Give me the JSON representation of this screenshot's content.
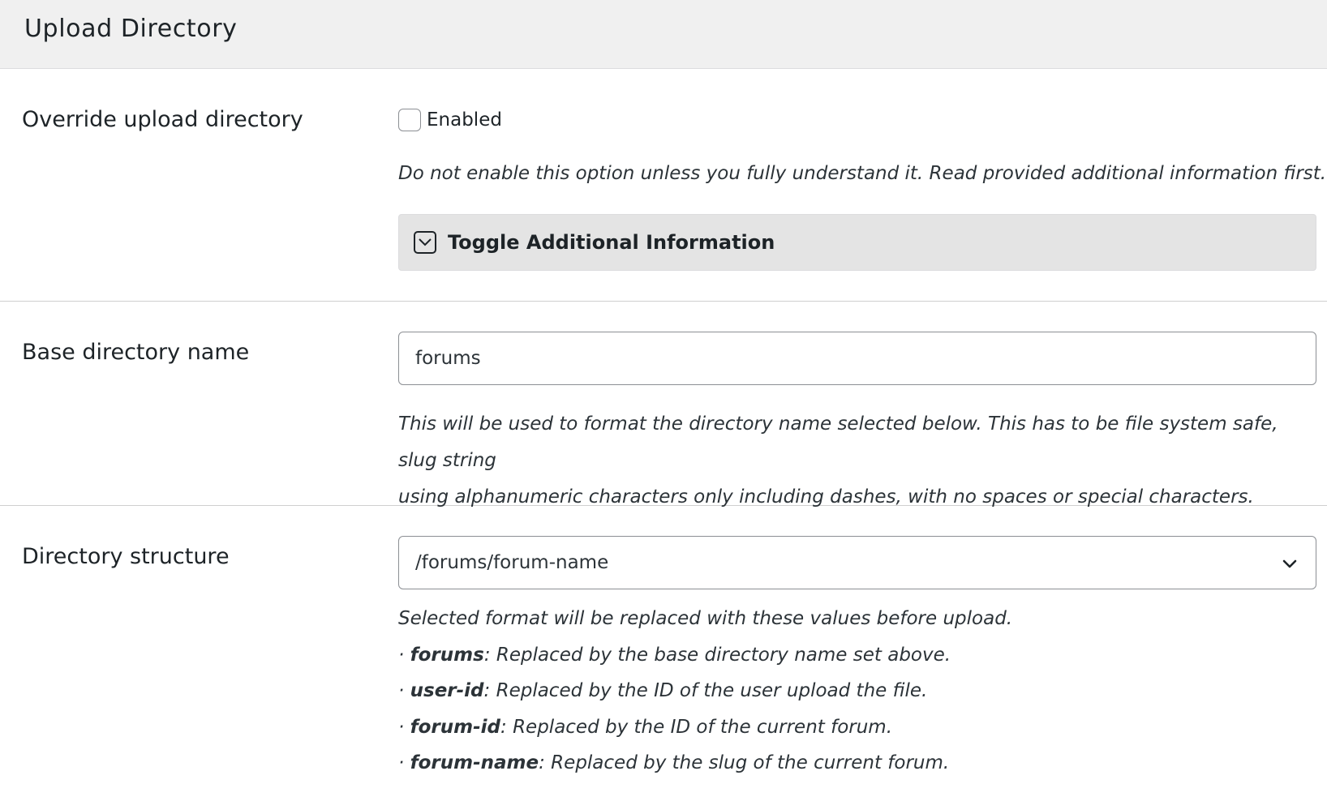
{
  "panel": {
    "title": "Upload Directory"
  },
  "override": {
    "label": "Override upload directory",
    "checkbox_label": "Enabled",
    "checked": false,
    "help": "Do not enable this option unless you fully understand it. Read provided additional information first.",
    "toggle_label": "Toggle Additional Information",
    "toggle_icon": "chevron-down-square-icon"
  },
  "base_dir": {
    "label": "Base directory name",
    "value": "forums",
    "help_line1": "This will be used to format the directory name selected below. This has to be file system safe, slug string",
    "help_line2": "using alphanumeric characters only including dashes, with no spaces or special characters."
  },
  "structure": {
    "label": "Directory structure",
    "selected": "/forums/forum-name",
    "intro": "Selected format will be replaced with these values before upload.",
    "items": [
      {
        "bullet": "· ",
        "token": "forums",
        "desc": ": Replaced by the base directory name set above."
      },
      {
        "bullet": "· ",
        "token": "user-id",
        "desc": ": Replaced by the ID of the user upload the file."
      },
      {
        "bullet": "· ",
        "token": "forum-id",
        "desc": ": Replaced by the ID of the current forum."
      },
      {
        "bullet": "· ",
        "token": "forum-name",
        "desc": ": Replaced by the slug of the current forum."
      }
    ]
  }
}
